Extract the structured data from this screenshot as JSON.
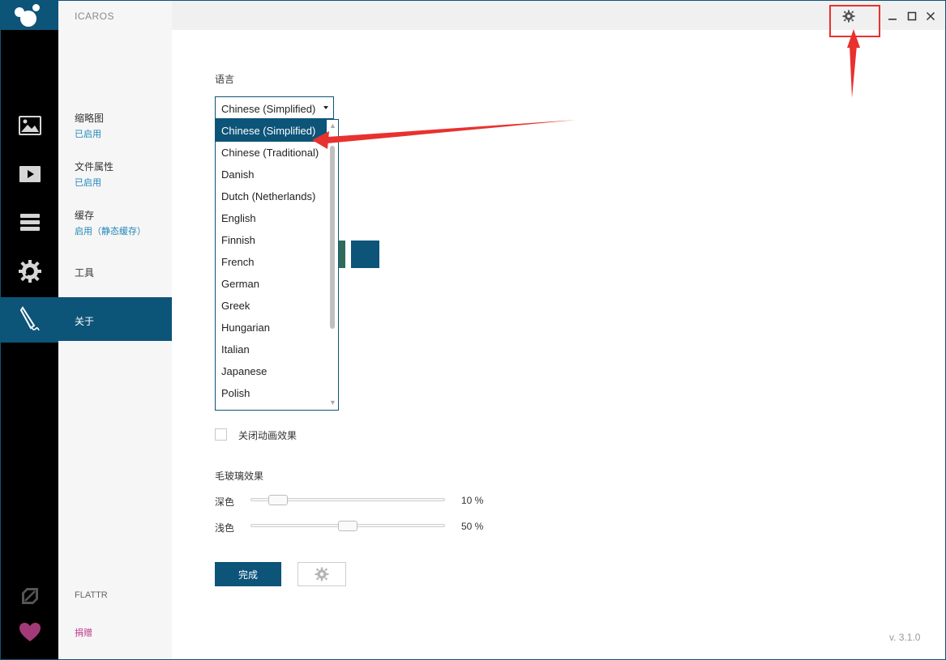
{
  "app": {
    "title": "ICAROS",
    "version": "v. 3.1.0"
  },
  "rail": {
    "icons": [
      "image-icon",
      "video-icon",
      "cache-stack-icon",
      "tools-gear-icon",
      "about-pen-icon",
      "flattr-icon",
      "heart-icon"
    ]
  },
  "nav": {
    "items": [
      {
        "label": "缩略图",
        "status": "已启用"
      },
      {
        "label": "文件属性",
        "status": "已启用"
      },
      {
        "label": "缓存",
        "status": "启用（静态缓存）"
      },
      {
        "label": "工具",
        "status": ""
      },
      {
        "label": "关于",
        "status": ""
      }
    ],
    "footer": {
      "flattr": "FLATTR",
      "donate": "捐赠"
    }
  },
  "content": {
    "language_label": "语言",
    "language_selected": "Chinese (Simplified)",
    "language_options": [
      "Chinese (Simplified)",
      "Chinese (Traditional)",
      "Danish",
      "Dutch (Netherlands)",
      "English",
      "Finnish",
      "French",
      "German",
      "Greek",
      "Hungarian",
      "Italian",
      "Japanese",
      "Polish"
    ],
    "swatch_colors": [
      "#2f6b5b",
      "#0d5479"
    ],
    "disable_animation_label": "关闭动画效果",
    "glass_title": "毛玻璃效果",
    "dark_label": "深色",
    "dark_value": "10 %",
    "dark_level": 0.1,
    "light_label": "浅色",
    "light_value": "50 %",
    "light_level": 0.5,
    "done_button": "完成"
  },
  "colors": {
    "accent": "#0d5479",
    "link": "#1f87b8",
    "donate": "#c0388f",
    "annotation": "#e8322f"
  }
}
